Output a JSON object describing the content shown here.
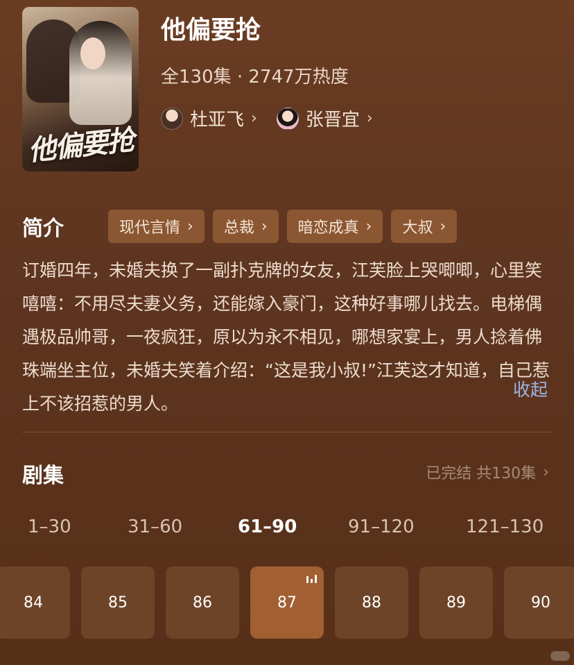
{
  "drama": {
    "title": "他偏要抢",
    "meta": "全130集 · 2747万热度",
    "poster_text": "他偏要抢",
    "actors": [
      {
        "name": "杜亚飞"
      },
      {
        "name": "张晋宜"
      }
    ]
  },
  "intro": {
    "heading": "简介",
    "tags": [
      "现代言情",
      "总裁",
      "暗恋成真",
      "大叔"
    ],
    "text": "订婚四年，未婚夫换了一副扑克牌的女友，江芙脸上哭唧唧，心里笑嘻嘻：不用尽夫妻义务，还能嫁入豪门，这种好事哪儿找去。电梯偶遇极品帅哥，一夜疯狂，原以为永不相见，哪想家宴上，男人捻着佛珠端坐主位，未婚夫笑着介绍：“这是我小叔!”江芙这才知道，自己惹上不该招惹的男人。",
    "collapse_label": "收起"
  },
  "episodes": {
    "heading": "剧集",
    "status": "已完结 共130集",
    "ranges": [
      "1–30",
      "31–60",
      "61–90",
      "91–120",
      "121–130"
    ],
    "active_range_index": 2,
    "items": [
      "84",
      "85",
      "86",
      "87",
      "88",
      "89",
      "90"
    ],
    "current": "87"
  },
  "icons": {
    "chevron": "chevron-right-icon",
    "playing": "playing-bars-icon"
  },
  "colors": {
    "background": "#5e3520",
    "tag_bg": "#8a5732",
    "episode_bg": "#6e4429",
    "episode_active_bg": "#a25f31",
    "link": "#9fb4e6"
  }
}
